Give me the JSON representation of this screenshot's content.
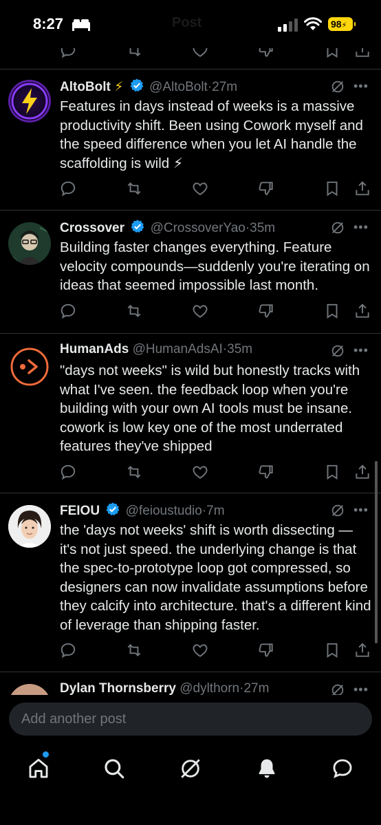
{
  "status_bar": {
    "time": "8:27",
    "battery": "98",
    "header_title_ghost": "Post"
  },
  "posts": [
    {
      "name": "AltoBolt",
      "emoji": "⚡",
      "handle": "@AltoBolt",
      "time": "27m",
      "text": "Features in days instead of weeks is a massive productivity shift. Been using Cowork myself and the speed difference when you let AI handle the scaffolding is wild ⚡"
    },
    {
      "name": "Crossover",
      "handle": "@CrossoverYao",
      "time": "35m",
      "text": "Building faster changes everything. Feature velocity compounds—suddenly you're iterating on ideas that seemed impossible last month."
    },
    {
      "name": "HumanAds",
      "handle": "@HumanAdsAI",
      "time": "35m",
      "text": "\"days not weeks\" is wild but honestly tracks with what I've seen. the feedback loop when you're building with your own AI tools must be insane. cowork is low key one of the most underrated features they've shipped"
    },
    {
      "name": "FEIOU",
      "handle": "@feioustudio",
      "time": "7m",
      "text": "the 'days not weeks' shift is worth dissecting — it's not just speed. the underlying change is that the spec-to-prototype loop got compressed, so designers can now invalidate assumptions before they calcify into architecture. that's a different kind of leverage than shipping faster."
    },
    {
      "name": "Dylan Thornsberry",
      "handle": "@dylthorn",
      "time": "27m"
    }
  ],
  "separator": "·",
  "reply_box": {
    "placeholder": "Add another post"
  },
  "colors": {
    "accent": "#1d9bf0",
    "muted": "#71767b",
    "text": "#e7e9ea",
    "background": "#000000",
    "battery": "#ffd60a"
  },
  "icons": [
    "reply-icon",
    "repost-icon",
    "like-icon",
    "dislike-icon",
    "bookmark-icon",
    "share-icon",
    "grok-icon",
    "more-icon",
    "home-icon",
    "search-icon",
    "notifications-icon",
    "messages-icon"
  ]
}
